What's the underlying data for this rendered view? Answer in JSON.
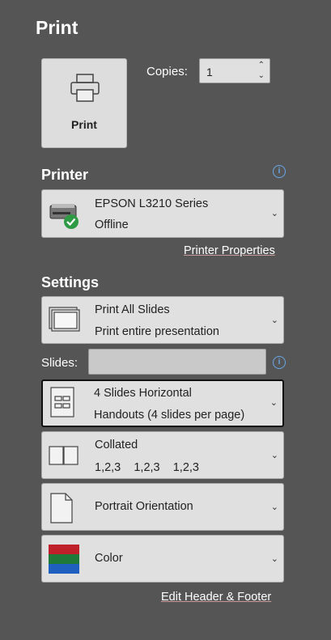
{
  "page": {
    "title": "Print"
  },
  "print_button": {
    "label": "Print",
    "icon": "printer-icon"
  },
  "copies": {
    "label": "Copies:",
    "value": "1"
  },
  "printer": {
    "section_title": "Printer",
    "name": "EPSON L3210 Series",
    "status": "Offline",
    "properties_link": "Printer Properties",
    "icon": "printer-ready-icon"
  },
  "settings": {
    "section_title": "Settings",
    "print_range": {
      "line1": "Print All Slides",
      "line2": "Print entire presentation"
    },
    "slides": {
      "label": "Slides:",
      "value": ""
    },
    "layout": {
      "line1": "4 Slides Horizontal",
      "line2": "Handouts (4 slides per page)"
    },
    "collation": {
      "line1": "Collated",
      "line2": "1,2,3    1,2,3    1,2,3"
    },
    "orientation": {
      "line1": "Portrait Orientation"
    },
    "color": {
      "line1": "Color"
    },
    "footer_link": "Edit Header & Footer"
  },
  "colors": {
    "background": "#555555",
    "dropdown": "#e0e0e0",
    "info": "#6aa7e8",
    "ok_green": "#2f9a44"
  }
}
